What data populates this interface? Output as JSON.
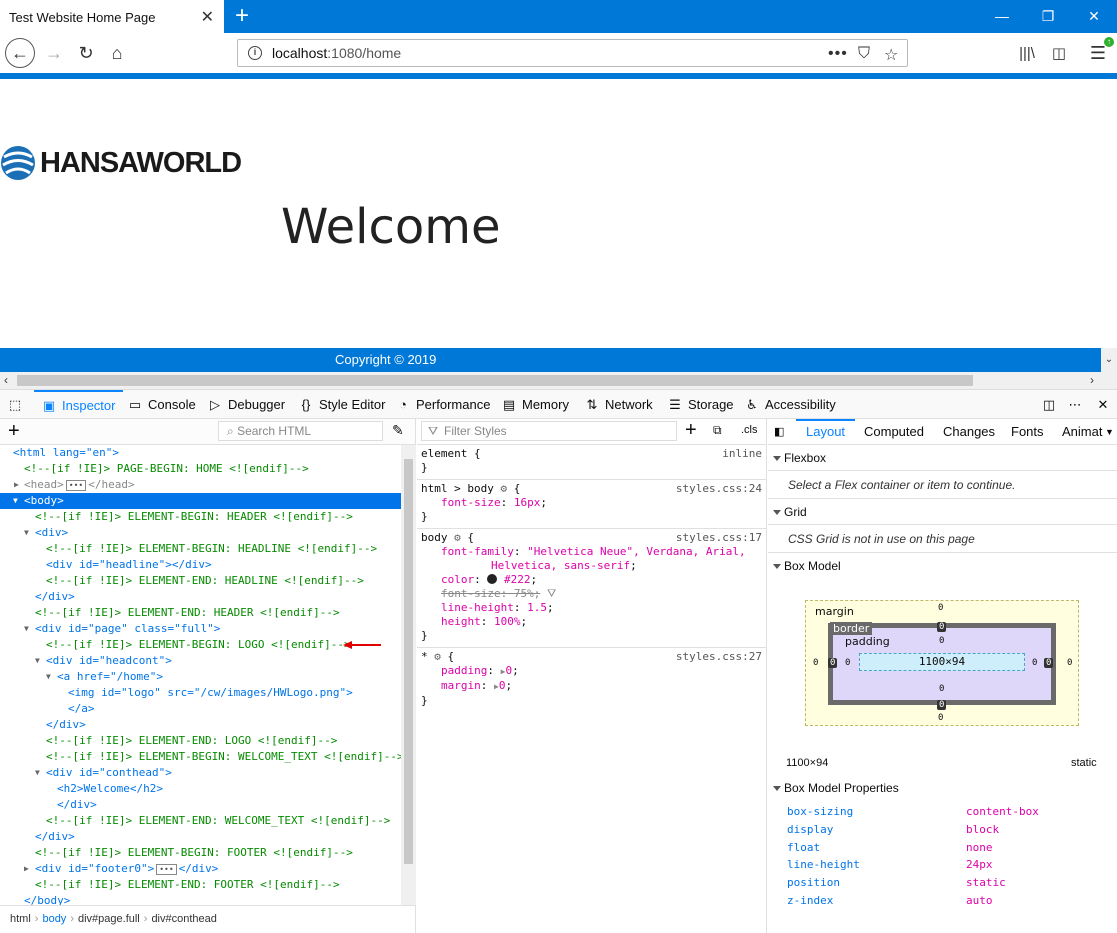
{
  "browser": {
    "tab_title": "Test Website Home Page",
    "url_host": "localhost",
    "url_path": ":1080/home",
    "urlbar_dots": "•••"
  },
  "page": {
    "logo_text": "HANSAWORLD",
    "heading": "Welcome",
    "footer": "Copyright © 2019"
  },
  "devtools": {
    "tabs": [
      {
        "label": "Inspector"
      },
      {
        "label": "Console"
      },
      {
        "label": "Debugger"
      },
      {
        "label": "Style Editor"
      },
      {
        "label": "Performance"
      },
      {
        "label": "Memory"
      },
      {
        "label": "Network"
      },
      {
        "label": "Storage"
      },
      {
        "label": "Accessibility"
      }
    ],
    "search_html_placeholder": "Search HTML",
    "filter_styles_placeholder": "Filter Styles",
    "cls_label": ".cls",
    "tree": {
      "l0": "<html lang=\"en\">",
      "l1": "<!--[if !IE]> PAGE-BEGIN: HOME <![endif]-->",
      "l2a": "<head>",
      "l2b": "</head>",
      "l3": "<body>",
      "l4": "<!--[if !IE]> ELEMENT-BEGIN: HEADER <![endif]-->",
      "l5": "<div>",
      "l6": "<!--[if !IE]> ELEMENT-BEGIN: HEADLINE <![endif]-->",
      "l7": "<div id=\"headline\"></div>",
      "l8": "<!--[if !IE]> ELEMENT-END: HEADLINE <![endif]-->",
      "l9": "</div>",
      "l10": "<!--[if !IE]> ELEMENT-END: HEADER <![endif]-->",
      "l11": "<div id=\"page\" class=\"full\">",
      "l12": "<!--[if !IE]> ELEMENT-BEGIN: LOGO <![endif]-->",
      "l13": "<div id=\"headcont\">",
      "l14": "<a href=\"/home\">",
      "l15": "<img id=\"logo\" src=\"/cw/images/HWLogo.png\">",
      "l16": "</a>",
      "l17": "</div>",
      "l18": "<!--[if !IE]> ELEMENT-END: LOGO <![endif]-->",
      "l19": "<!--[if !IE]> ELEMENT-BEGIN: WELCOME_TEXT <![endif]-->",
      "l20": "<div id=\"conthead\">",
      "l21": "<h2>Welcome</h2>",
      "l22": "</div>",
      "l23": "<!--[if !IE]> ELEMENT-END: WELCOME_TEXT <![endif]-->",
      "l24": "</div>",
      "l25": "<!--[if !IE]> ELEMENT-BEGIN: FOOTER <![endif]-->",
      "l26a": "<div id=\"footer0\">",
      "l26b": "</div>",
      "l27": "<!--[if !IE]> ELEMENT-END: FOOTER <![endif]-->",
      "l28": "</body>"
    },
    "breadcrumb": [
      "html",
      "body",
      "div#page.full",
      "div#conthead"
    ],
    "rules": {
      "r1_sel": "element {",
      "r1_src": "inline",
      "r2_sel": "html > body",
      "r2_src": "styles.css:24",
      "r2_p1n": "font-size",
      "r2_p1v": "16px",
      "r3_sel": "body",
      "r3_src": "styles.css:17",
      "r3_p1n": "font-family",
      "r3_p1v": "\"Helvetica Neue\", Verdana, Arial,",
      "r3_p1v2": "Helvetica, sans-serif",
      "r3_p2n": "color",
      "r3_p2v": "#222",
      "r3_p3n": "font-size",
      "r3_p3v": "75%",
      "r3_p4n": "line-height",
      "r3_p4v": "1.5",
      "r3_p5n": "height",
      "r3_p5v": "100%",
      "r4_sel": "*",
      "r4_src": "styles.css:27",
      "r4_p1n": "padding",
      "r4_p1v": "0",
      "r4_p2n": "margin",
      "r4_p2v": "0",
      "close": "}"
    },
    "layout_tabs": [
      "Layout",
      "Computed",
      "Changes",
      "Fonts",
      "Animat"
    ],
    "flexbox_title": "Flexbox",
    "flexbox_msg": "Select a Flex container or item to continue.",
    "grid_title": "Grid",
    "grid_msg": "CSS Grid is not in use on this page",
    "boxmodel_title": "Box Model",
    "boxmodel": {
      "margin_label": "margin",
      "border_label": "border",
      "padding_label": "padding",
      "content_size": "1100×94",
      "zero": "0"
    },
    "element_size": "1100×94",
    "element_position": "static",
    "bm_props_title": "Box Model Properties",
    "bm_props": [
      {
        "name": "box-sizing",
        "value": "content-box"
      },
      {
        "name": "display",
        "value": "block"
      },
      {
        "name": "float",
        "value": "none"
      },
      {
        "name": "line-height",
        "value": "24px"
      },
      {
        "name": "position",
        "value": "static"
      },
      {
        "name": "z-index",
        "value": "auto"
      }
    ]
  },
  "colors": {
    "brand_blue": "#0078d7",
    "selection": "#0074e8",
    "arrow_red": "#e00000"
  }
}
